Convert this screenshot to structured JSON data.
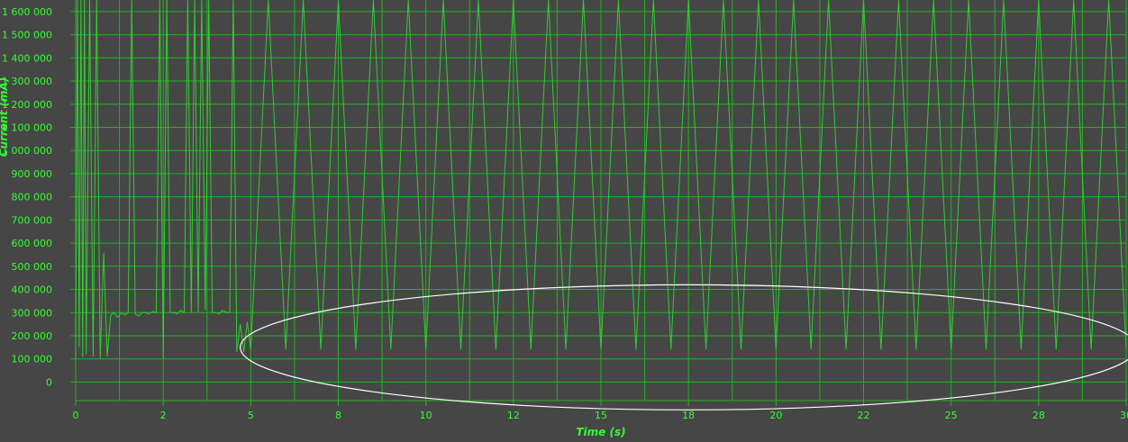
{
  "chart_data": {
    "type": "line",
    "title": "",
    "xlabel": "Time  (s)",
    "ylabel": "Current  (mA)",
    "xlim": [
      0,
      30
    ],
    "ylim": [
      -80000,
      1650000
    ],
    "x_ticks": [
      {
        "value": 0,
        "label": "0"
      },
      {
        "value": 2.5,
        "label": "2"
      },
      {
        "value": 5,
        "label": "5"
      },
      {
        "value": 7.5,
        "label": "8"
      },
      {
        "value": 10,
        "label": "10"
      },
      {
        "value": 12.5,
        "label": "12"
      },
      {
        "value": 15,
        "label": "15"
      },
      {
        "value": 17.5,
        "label": "18"
      },
      {
        "value": 20,
        "label": "20"
      },
      {
        "value": 22.5,
        "label": "22"
      },
      {
        "value": 25,
        "label": "25"
      },
      {
        "value": 27.5,
        "label": "28"
      },
      {
        "value": 30,
        "label": "30"
      }
    ],
    "y_ticks": [
      {
        "value": 0,
        "label": "0"
      },
      {
        "value": 100000,
        "label": "100 000"
      },
      {
        "value": 200000,
        "label": "200 000"
      },
      {
        "value": 300000,
        "label": "300 000"
      },
      {
        "value": 400000,
        "label": "400 000"
      },
      {
        "value": 500000,
        "label": "500 000"
      },
      {
        "value": 600000,
        "label": "600 000"
      },
      {
        "value": 700000,
        "label": "700 000"
      },
      {
        "value": 800000,
        "label": "800 000"
      },
      {
        "value": 900000,
        "label": "900 000"
      },
      {
        "value": 1000000,
        "label": "1 000 000"
      },
      {
        "value": 1100000,
        "label": "1 100 000"
      },
      {
        "value": 1200000,
        "label": "1 200 000"
      },
      {
        "value": 1300000,
        "label": "1 300 000"
      },
      {
        "value": 1400000,
        "label": "1 400 000"
      },
      {
        "value": 1500000,
        "label": "1 500 000"
      },
      {
        "value": 1600000,
        "label": "1 600 000"
      }
    ],
    "grid": true,
    "legend": "none",
    "colors": {
      "background": "#464646",
      "grid": "#22b322",
      "series": "#33cc33",
      "text": "#33ff33",
      "highlight": "#ffffff"
    },
    "series": [
      {
        "x": [
          0,
          0.05,
          0.1,
          0.15,
          0.2,
          0.25,
          0.3,
          0.4,
          0.5,
          0.6,
          0.7,
          0.8,
          0.9,
          1.0,
          1.1,
          1.2,
          1.3,
          1.4,
          1.5,
          1.6,
          1.7,
          1.8,
          1.9,
          2.0,
          2.1,
          2.2,
          2.3,
          2.4,
          2.5,
          2.6,
          2.7,
          2.8,
          2.9,
          3.0,
          3.1,
          3.2,
          3.3,
          3.4,
          3.5,
          3.6,
          3.7,
          3.8,
          3.9,
          4.0,
          4.1,
          4.2,
          4.3,
          4.4,
          4.5,
          4.6,
          4.7,
          4.8,
          4.9,
          5.0,
          5.5,
          6.0,
          6.5,
          7.0,
          7.5,
          8.0,
          8.5,
          9.0,
          9.5,
          10.0,
          10.5,
          11.0,
          11.5,
          12.0,
          12.5,
          13.0,
          13.5,
          14.0,
          14.5,
          15.0,
          15.5,
          16.0,
          16.5,
          17.0,
          17.5,
          18.0,
          18.5,
          19.0,
          19.5,
          20.0,
          20.5,
          21.0,
          21.5,
          22.0,
          22.5,
          23.0,
          23.5,
          24.0,
          24.5,
          25.0,
          25.5,
          26.0,
          26.5,
          27.0,
          27.5,
          28.0,
          28.5,
          29.0,
          29.5,
          30.0
        ],
        "values": [
          100000,
          1650000,
          150000,
          1650000,
          110000,
          1650000,
          120000,
          1650000,
          110000,
          1650000,
          100000,
          560000,
          110000,
          290000,
          300000,
          280000,
          300000,
          290000,
          300000,
          1650000,
          295000,
          285000,
          300000,
          300000,
          295000,
          305000,
          300000,
          1650000,
          100000,
          1650000,
          300000,
          300000,
          295000,
          310000,
          300000,
          1650000,
          300000,
          1650000,
          300000,
          1650000,
          310000,
          1650000,
          300000,
          300000,
          295000,
          310000,
          300000,
          300000,
          1650000,
          130000,
          250000,
          130000,
          260000,
          140000,
          1650000,
          140000,
          1650000,
          140000,
          1650000,
          140000,
          1650000,
          140000,
          1650000,
          140000,
          1650000,
          140000,
          1650000,
          140000,
          1650000,
          140000,
          1650000,
          140000,
          1650000,
          140000,
          1650000,
          140000,
          1650000,
          140000,
          1650000,
          140000,
          1650000,
          140000,
          1650000,
          140000,
          1650000,
          140000,
          1650000,
          140000,
          1650000,
          140000,
          1650000,
          140000,
          1650000,
          140000,
          1650000,
          140000,
          1650000,
          140000,
          1650000,
          140000,
          1650000,
          140000,
          1650000,
          140000
        ]
      }
    ],
    "annotations": [
      {
        "type": "ellipse",
        "cx": 17.5,
        "cy": 150000,
        "rx": 12.8,
        "ry": 270000
      }
    ]
  }
}
